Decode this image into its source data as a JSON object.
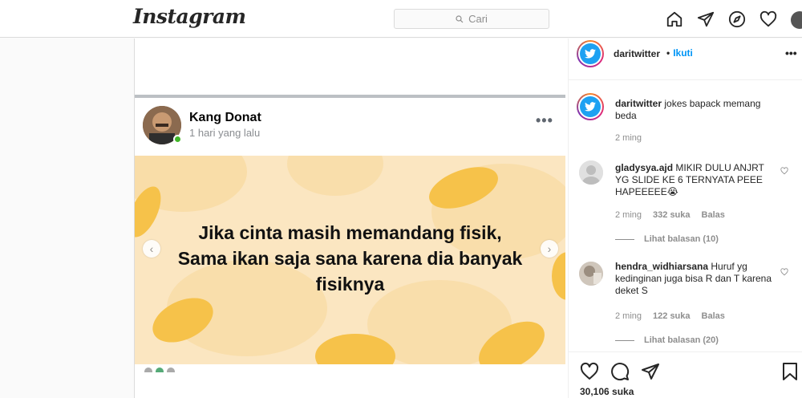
{
  "header": {
    "logo_text": "Instagram",
    "search_placeholder": "Cari",
    "nav_icons": [
      "home-icon",
      "send-icon",
      "explore-icon",
      "heart-icon",
      "profile-avatar"
    ]
  },
  "post_image": {
    "author_name": "Kang Donat",
    "time": "1 hari yang lalu",
    "more": "•••",
    "meme_lines": [
      "Jika cinta masih memandang fisik,",
      "Sama ikan saja sana karena dia banyak",
      "fisiknya"
    ],
    "prev_arrow": "‹",
    "next_arrow": "›",
    "colors": {
      "meme_bg": "#fbe6c1",
      "blob": "#f6c24a"
    }
  },
  "sidebar": {
    "username": "daritwitter",
    "separator": "•",
    "follow_label": "Ikuti",
    "more": "•••",
    "comments": [
      {
        "user": "daritwitter",
        "text": "jokes bapack memang beda",
        "time": "2 ming"
      },
      {
        "user": "gladysya.ajd",
        "text": "MIKIR DULU ANJRT YG SLIDE KE 6 TERNYATA PEEE HAPEEEEE😭",
        "time": "2 ming",
        "likes": "332 suka",
        "reply": "Balas",
        "view_replies": "Lihat balasan (10)"
      },
      {
        "user": "hendra_widhiarsana",
        "text": "Huruf yg kedinginan juga bisa R dan T karena deket S",
        "time": "2 ming",
        "likes": "122 suka",
        "reply": "Balas",
        "view_replies": "Lihat balasan (20)"
      }
    ],
    "likes_count": "30,106 suka"
  }
}
